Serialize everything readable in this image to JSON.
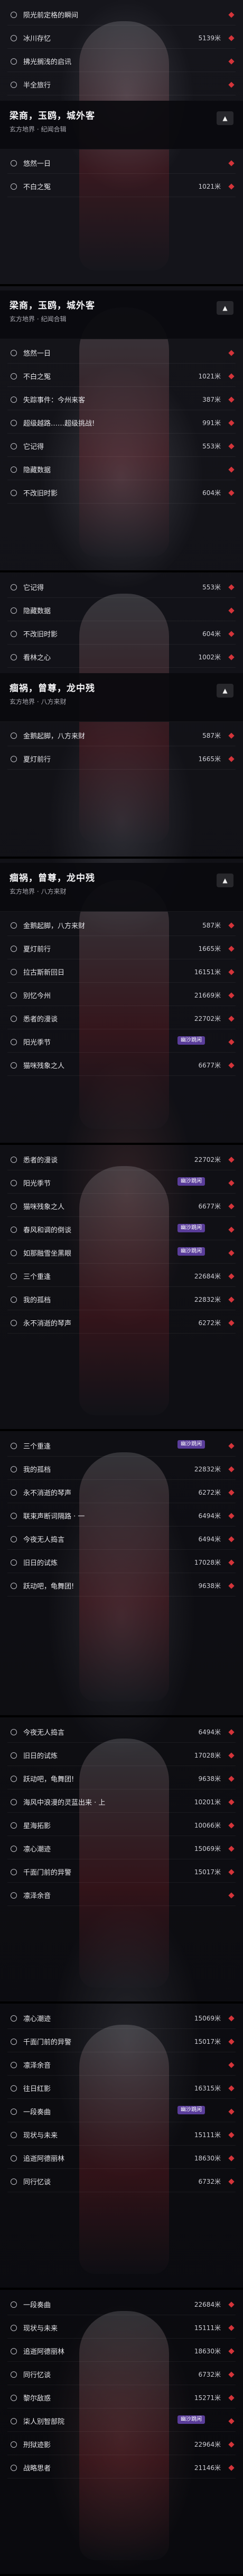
{
  "badge_text": "幽沙跳闲",
  "screens": [
    {
      "header": null,
      "rows": [
        {
          "label": "陨光前定格的瞬间",
          "dist": ""
        },
        {
          "label": "冰川存忆",
          "dist": "5139米"
        },
        {
          "label": "拂光搁浅的启讯",
          "dist": ""
        },
        {
          "label": "半全旅行",
          "dist": ""
        }
      ],
      "panel": {
        "title": "梁商，玉鸥，城外客",
        "sub": "玄方地界 · 纪闻合辑"
      },
      "rows2": [
        {
          "label": "悠然一日",
          "dist": ""
        },
        {
          "label": "不白之冤",
          "dist": "1021米"
        }
      ]
    },
    {
      "header": {
        "title": "梁商，玉鸥，城外客",
        "sub": "玄方地界 · 纪闻合辑"
      },
      "rows": [
        {
          "label": "悠然一日",
          "dist": ""
        },
        {
          "label": "不白之冤",
          "dist": "1021米"
        },
        {
          "label": "失踪事件：今州来客",
          "dist": "387米"
        },
        {
          "label": "超级越路……超级挑战!",
          "dist": "991米"
        },
        {
          "label": "它记得",
          "dist": "553米"
        },
        {
          "label": "隐藏数据",
          "dist": ""
        },
        {
          "label": "不改旧时影",
          "dist": "604米"
        }
      ]
    },
    {
      "header": null,
      "rows": [
        {
          "label": "它记得",
          "dist": "553米"
        },
        {
          "label": "隐藏数据",
          "dist": ""
        },
        {
          "label": "不改旧时影",
          "dist": "604米"
        },
        {
          "label": "看林之心",
          "dist": "1002米"
        }
      ],
      "panel": {
        "title": "痼祸，曾尊，龙中残",
        "sub": "玄方地界 · 八方来财"
      },
      "rows2": [
        {
          "label": "金鹅起脚，八方来财",
          "dist": "587米"
        },
        {
          "label": "夏灯前行",
          "dist": "1665米"
        }
      ]
    },
    {
      "header": {
        "title": "痼祸，曾尊，龙中残",
        "sub": "玄方地界 · 八方来财"
      },
      "rows": [
        {
          "label": "金鹅起脚，八方来财",
          "dist": "587米"
        },
        {
          "label": "夏灯前行",
          "dist": "1665米"
        },
        {
          "label": "拉古斯新回日",
          "dist": "16151米"
        },
        {
          "label": "别忆今州",
          "dist": "21669米"
        },
        {
          "label": "悉者的漫谈",
          "dist": "22702米"
        },
        {
          "label": "阳光季节",
          "dist": "",
          "badge": true
        },
        {
          "label": "猫咪残象之人",
          "dist": "6677米"
        }
      ]
    },
    {
      "header": null,
      "rows": [
        {
          "label": "悉者的漫谈",
          "dist": "22702米"
        },
        {
          "label": "阳光季节",
          "dist": "",
          "badge": true
        },
        {
          "label": "猫咪残象之人",
          "dist": "6677米"
        },
        {
          "label": "春风和调的倒谈",
          "dist": "",
          "badge": true
        },
        {
          "label": "如那融雪坐黑眼",
          "dist": "",
          "badge": true
        },
        {
          "label": "三个重逢",
          "dist": "22684米"
        },
        {
          "label": "我的孤档",
          "dist": "22832米"
        },
        {
          "label": "永不消逝的琴声",
          "dist": "6272米"
        }
      ]
    },
    {
      "header": null,
      "rows": [
        {
          "label": "三个重逢",
          "dist": "",
          "badge": true
        },
        {
          "label": "我的孤档",
          "dist": "22832米"
        },
        {
          "label": "永不消逝的琴声",
          "dist": "6272米"
        },
        {
          "label": "联束声断词隔路 · 一",
          "dist": "6494米"
        },
        {
          "label": "今夜无人捣言",
          "dist": "6494米"
        },
        {
          "label": "旧日的试炼",
          "dist": "17028米"
        },
        {
          "label": "跃动吧，龟舞团!",
          "dist": "9638米"
        }
      ]
    },
    {
      "header": null,
      "rows": [
        {
          "label": "今夜无人捣言",
          "dist": "6494米"
        },
        {
          "label": "旧日的试炼",
          "dist": "17028米"
        },
        {
          "label": "跃动吧，龟舞团!",
          "dist": "9638米"
        },
        {
          "label": "海风中浪漫的灵蓝出来 · 上",
          "dist": "10201米"
        },
        {
          "label": "星海拓影",
          "dist": "10066米"
        },
        {
          "label": "凛心潮迹",
          "dist": "15069米"
        },
        {
          "label": "千面门前的异警",
          "dist": "15017米"
        },
        {
          "label": "凛泽余音",
          "dist": ""
        }
      ]
    },
    {
      "header": null,
      "rows": [
        {
          "label": "凛心潮迹",
          "dist": "15069米"
        },
        {
          "label": "千面门前的异警",
          "dist": "15017米"
        },
        {
          "label": "凛泽余音",
          "dist": ""
        },
        {
          "label": "往日红影",
          "dist": "16315米"
        },
        {
          "label": "一段奏曲",
          "dist": "",
          "badge": true
        },
        {
          "label": "现状与未来",
          "dist": "15111米"
        },
        {
          "label": "追逝阿德丽林",
          "dist": "18630米"
        },
        {
          "label": "同行忆谈",
          "dist": "6732米"
        }
      ]
    },
    {
      "header": null,
      "rows": [
        {
          "label": "一段奏曲",
          "dist": "22684米"
        },
        {
          "label": "现状与未来",
          "dist": "15111米"
        },
        {
          "label": "追逝阿德丽林",
          "dist": "18630米"
        },
        {
          "label": "同行忆谈",
          "dist": "6732米"
        },
        {
          "label": "黎尔敌惑",
          "dist": "15271米"
        },
        {
          "label": "柒人别智部院",
          "dist": "",
          "badge": true
        },
        {
          "label": "刑狱迹影",
          "dist": "22964米"
        },
        {
          "label": "战略思者",
          "dist": "21146米"
        }
      ]
    }
  ]
}
